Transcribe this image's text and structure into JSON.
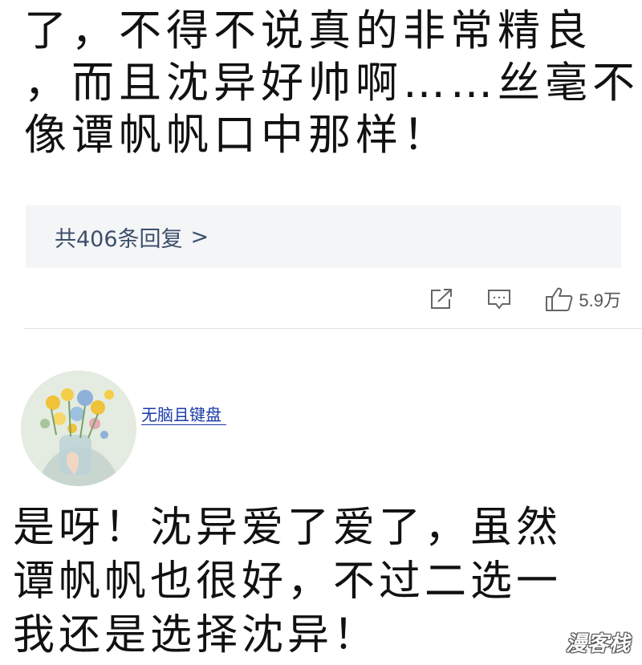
{
  "post": {
    "lines": [
      "了，不得不说真的非常精良",
      "，而且沈异好帅啊……丝毫不",
      "像谭帆帆口中那样！"
    ]
  },
  "replies": {
    "label": "共406条回复",
    "chevron": ">"
  },
  "actions": {
    "share_icon": "share-icon",
    "comment_icon": "comment-icon",
    "like_icon": "thumbs-up-icon",
    "like_count": "5.9万"
  },
  "comment": {
    "username": "无脑且键盘",
    "lines": [
      "是呀！沈异爱了爱了，虽然",
      "谭帆帆也很好，不过二选一",
      "我还是选择沈异！"
    ]
  },
  "watermark": {
    "text": "漫客栈"
  },
  "colors": {
    "link": "#1a3aa8",
    "reply_text": "#3d4f6b",
    "reply_bg": "#f4f5f7"
  }
}
